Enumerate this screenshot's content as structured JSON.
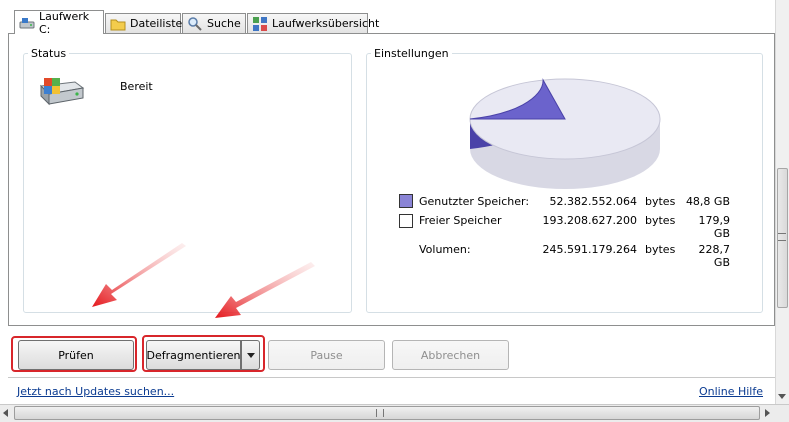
{
  "tabs": [
    {
      "label": "Laufwerk C:",
      "icon": "drive-icon",
      "active": true
    },
    {
      "label": "Dateiliste",
      "icon": "folder-icon"
    },
    {
      "label": "Suche",
      "icon": "magnifier-icon"
    },
    {
      "label": "Laufwerksübersicht",
      "icon": "drive-map-icon"
    }
  ],
  "status": {
    "title": "Status",
    "text": "Bereit"
  },
  "settings": {
    "title": "Einstellungen",
    "used_fraction": 0.213,
    "used_color": "#6b63cc",
    "free_color": "#e9e9f3",
    "rows": [
      {
        "label": "Genutzter Speicher:",
        "bytes": "52.382.552.064",
        "unit": "bytes",
        "size": "48,8 GB",
        "swatch": "#8a84d6"
      },
      {
        "label": "Freier Speicher",
        "bytes": "193.208.627.200",
        "unit": "bytes",
        "size": "179,9 GB",
        "swatch": "#ffffff"
      },
      {
        "label": "Volumen:",
        "bytes": "245.591.179.264",
        "unit": "bytes",
        "size": "228,7 GB"
      }
    ]
  },
  "buttons": {
    "check": "Prüfen",
    "defrag": "Defragmentieren",
    "pause": "Pause",
    "cancel": "Abbrechen"
  },
  "footer": {
    "updates_link": "Jetzt nach Updates suchen...",
    "help_link": "Online Hilfe"
  },
  "colors": {
    "highlight_red": "#d8262b",
    "link_blue": "#0b3b91"
  }
}
